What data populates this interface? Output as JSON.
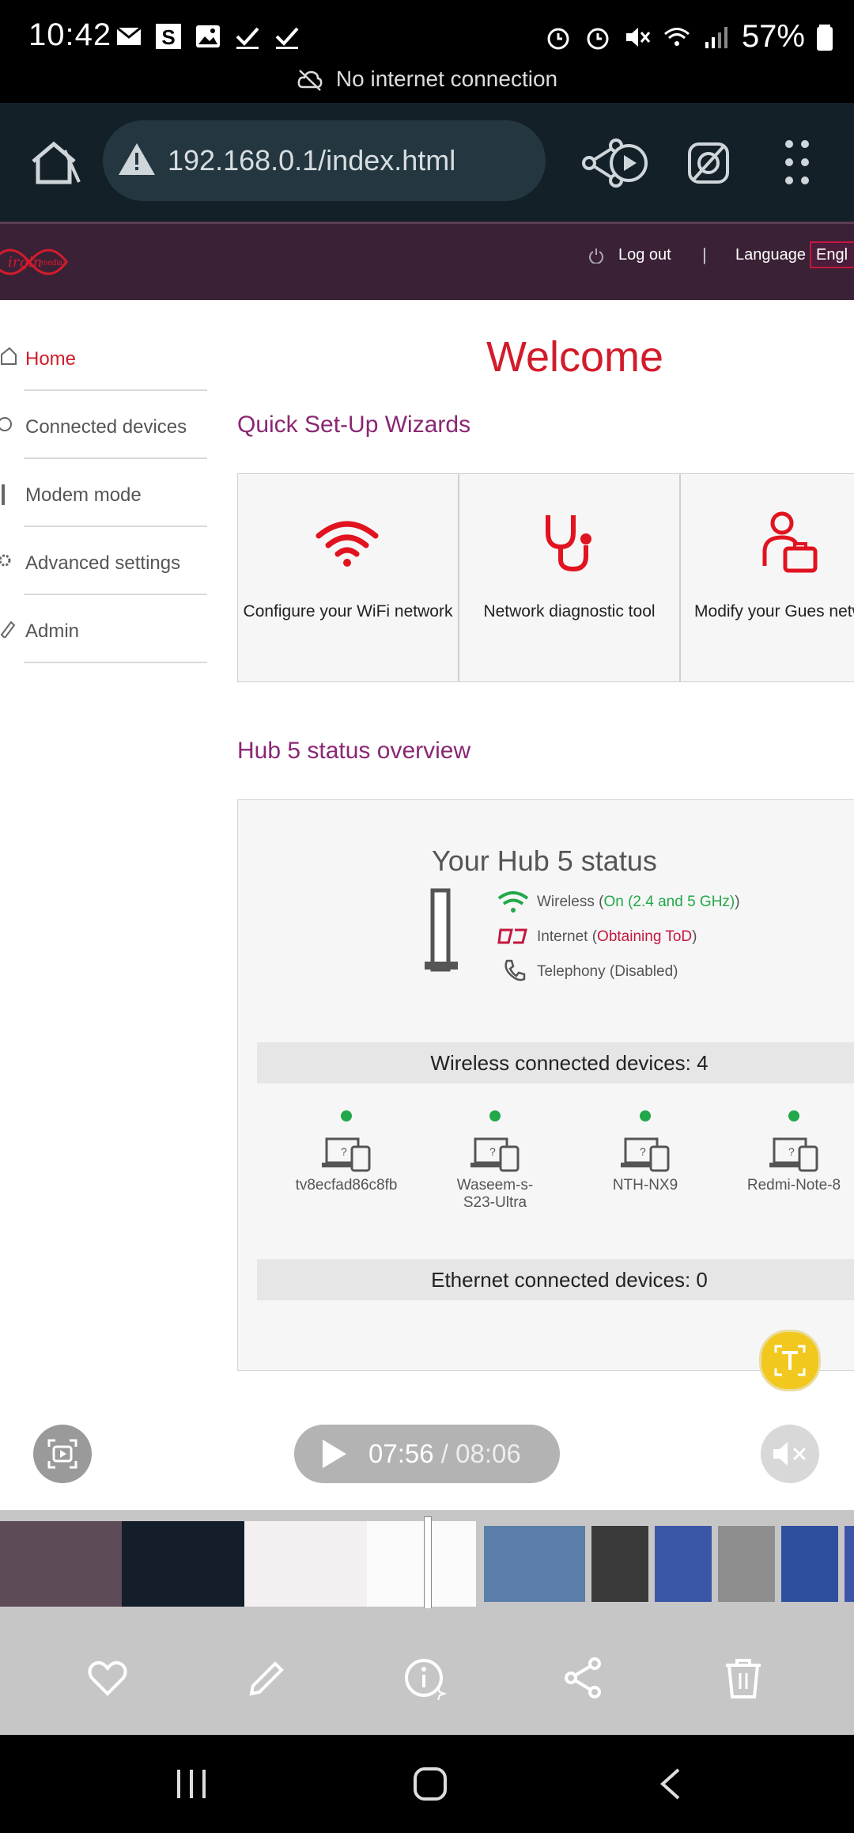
{
  "status_bar": {
    "time": "10:42",
    "battery": "57%",
    "connection_notice": "No internet connection"
  },
  "browser": {
    "url": "192.168.0.1/index.html"
  },
  "router_header": {
    "logout": "Log out",
    "separator": "|",
    "language_label": "Language",
    "language_value": "Engl"
  },
  "sidebar": {
    "items": [
      {
        "label": "Home",
        "active": true
      },
      {
        "label": "Connected devices"
      },
      {
        "label": "Modem mode"
      },
      {
        "label": "Advanced settings"
      },
      {
        "label": "Admin"
      }
    ]
  },
  "main": {
    "welcome": "Welcome",
    "wizards_heading": "Quick Set-Up Wizards",
    "wizards": [
      {
        "label": "Configure your WiFi network",
        "icon": "wifi-icon"
      },
      {
        "label": "Network diagnostic tool",
        "icon": "stethoscope-icon"
      },
      {
        "label": "Modify your Gues network",
        "icon": "guest-user-icon"
      }
    ],
    "status_heading": "Hub 5 status overview",
    "status": {
      "title": "Your Hub 5 status",
      "wireless_label": "Wireless (",
      "wireless_value": "On (2.4 and 5 GHz)",
      "wireless_close": ")",
      "internet_label": "Internet (",
      "internet_value": "Obtaining ToD",
      "internet_close": ")",
      "telephony": "Telephony (Disabled)",
      "wireless_devices": "Wireless connected devices: 4",
      "ethernet_devices": "Ethernet connected devices: 0",
      "devices": [
        {
          "name": "tv8ecfad86c8fb"
        },
        {
          "name": "Waseem-s-S23-Ultra"
        },
        {
          "name": "NTH-NX9"
        },
        {
          "name": "Redmi-Note-8"
        }
      ]
    }
  },
  "video": {
    "current": "07:56",
    "separator": "/",
    "duration": "08:06"
  },
  "colors": {
    "accent_red": "#d21c2b",
    "accent_purple": "#8a2773",
    "status_green": "#22a84a",
    "header_bg": "#3b2136"
  }
}
